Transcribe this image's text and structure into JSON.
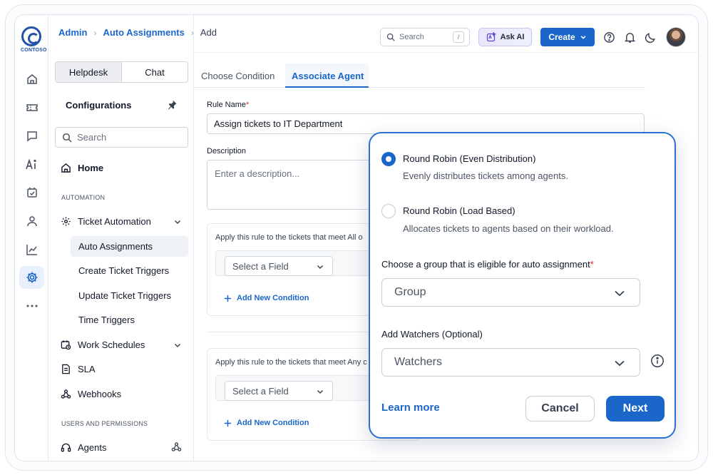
{
  "brand": {
    "logo_text": "CONTOSO"
  },
  "breadcrumb": [
    {
      "label": "Admin"
    },
    {
      "label": "Auto Assignments"
    },
    {
      "label": "Add"
    }
  ],
  "topbar": {
    "search_placeholder": "Search",
    "shortcut": "/",
    "ask_ai": "Ask AI",
    "create": "Create"
  },
  "rail_icons": [
    "home-icon",
    "ticket-icon",
    "chat-icon",
    "ai-icon",
    "task-icon",
    "user-icon",
    "chart-icon",
    "settings-icon",
    "more-icon"
  ],
  "sidebar": {
    "segments": [
      "Helpdesk",
      "Chat"
    ],
    "title": "Configurations",
    "search_placeholder": "Search",
    "home": "Home",
    "section_automation": "AUTOMATION",
    "ticket_automation": "Ticket Automation",
    "sub_items": [
      "Auto Assignments",
      "Create Ticket Triggers",
      "Update Ticket Triggers",
      "Time Triggers"
    ],
    "work_schedules": "Work Schedules",
    "sla": "SLA",
    "webhooks": "Webhooks",
    "section_users": "USERS AND PERMISSIONS",
    "agents": "Agents"
  },
  "tabs": [
    "Choose Condition",
    "Associate Agent"
  ],
  "form": {
    "rule_name_label": "Rule Name",
    "rule_name_value": "Assign tickets to IT Department",
    "description_label": "Description",
    "description_placeholder": "Enter a description...",
    "cond_all_text": "Apply this rule to the tickets that meet All o",
    "cond_any_text": "Apply this rule to the tickets that meet Any c",
    "select_field": "Select a Field",
    "add_condition": "Add New Condition"
  },
  "popup": {
    "options": [
      {
        "title": "Round Robin (Even Distribution)",
        "desc": "Evenly distributes tickets among agents.",
        "selected": true
      },
      {
        "title": "Round Robin (Load Based)",
        "desc": "Allocates tickets to agents based on their workload.",
        "selected": false
      }
    ],
    "group_label": "Choose a group that is eligible for auto assignment",
    "group_placeholder": "Group",
    "watchers_label": "Add Watchers (Optional)",
    "watchers_placeholder": "Watchers",
    "learn_more": "Learn more",
    "cancel": "Cancel",
    "next": "Next"
  },
  "colors": {
    "accent": "#1b66c9",
    "popup_border": "#2a6fd2",
    "required": "#dc2626"
  }
}
